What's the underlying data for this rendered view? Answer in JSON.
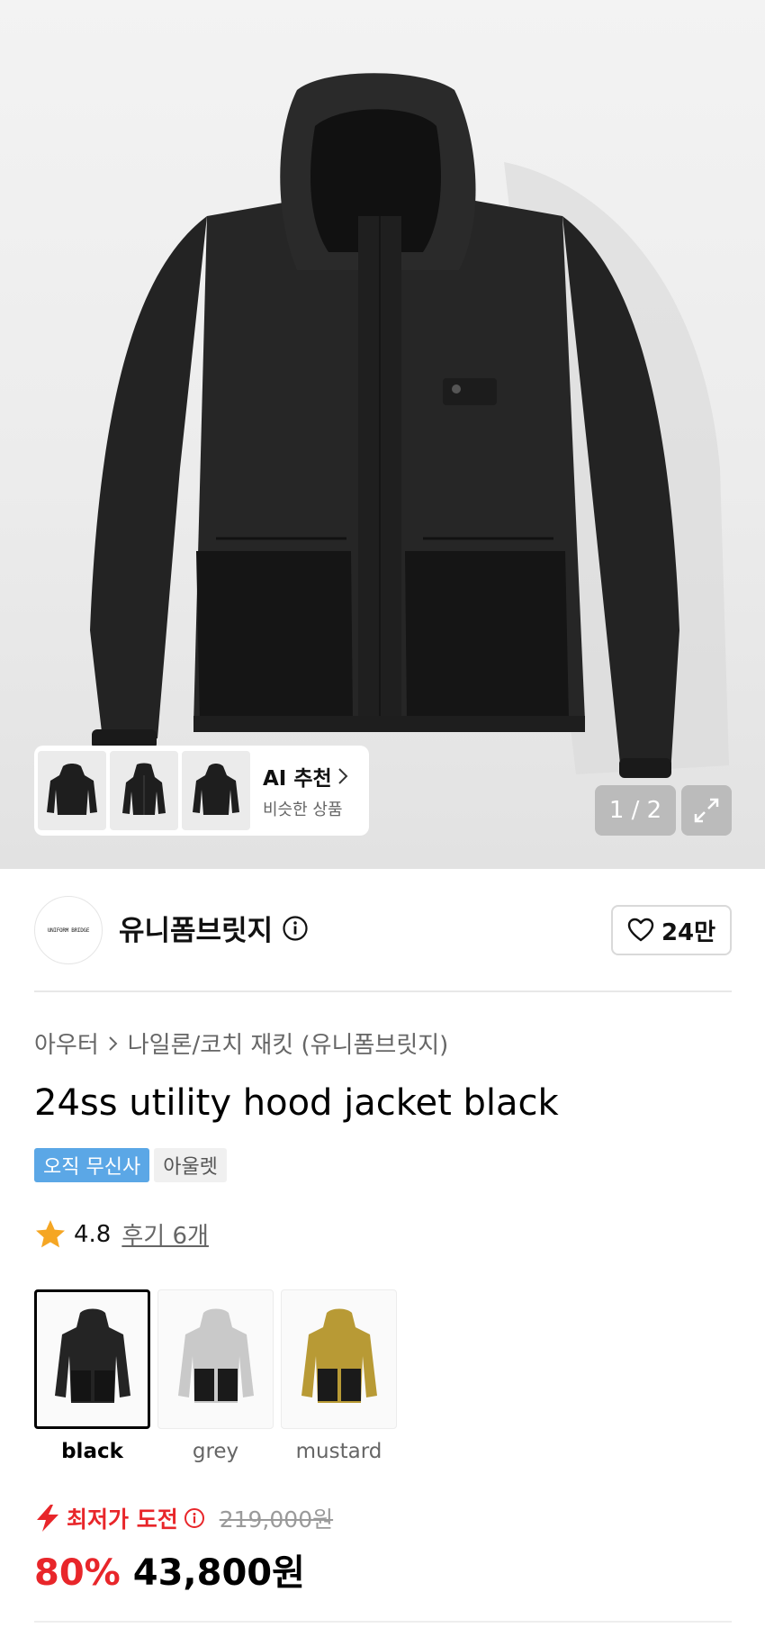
{
  "gallery": {
    "thumbs": [
      "front-view",
      "front-view-zipped",
      "back-view"
    ],
    "ai_title": "AI 추천",
    "ai_sub": "비슷한 상품",
    "counter": "1 / 2"
  },
  "brand": {
    "logo_text": "UNIFORM BRIDGE",
    "name": "유니폼브릿지",
    "likes": "24만"
  },
  "product": {
    "breadcrumb": [
      "아우터",
      "나일론/코치 재킷 (유니폼브릿지)"
    ],
    "title": "24ss utility hood jacket black",
    "badges": [
      "오직 무신사",
      "아울렛"
    ],
    "rating": "4.8",
    "reviews": "후기 6개",
    "colors": [
      {
        "label": "black",
        "hex": "#222222"
      },
      {
        "label": "grey",
        "hex": "#c9c9c9"
      },
      {
        "label": "mustard",
        "hex": "#b89a35"
      }
    ],
    "lowest_label": "최저가 도전",
    "original_price": "219,000원",
    "discount": "80%",
    "price": "43,800원"
  },
  "colors": {
    "accent_red": "#e8262a",
    "badge_blue": "#5ba7e6",
    "star": "#f5a623"
  },
  "icons": {
    "info": "info-icon",
    "heart": "heart-icon",
    "chevron": "chevron-right-icon",
    "expand": "expand-icon",
    "star": "star-icon",
    "lightning": "lightning-icon"
  }
}
